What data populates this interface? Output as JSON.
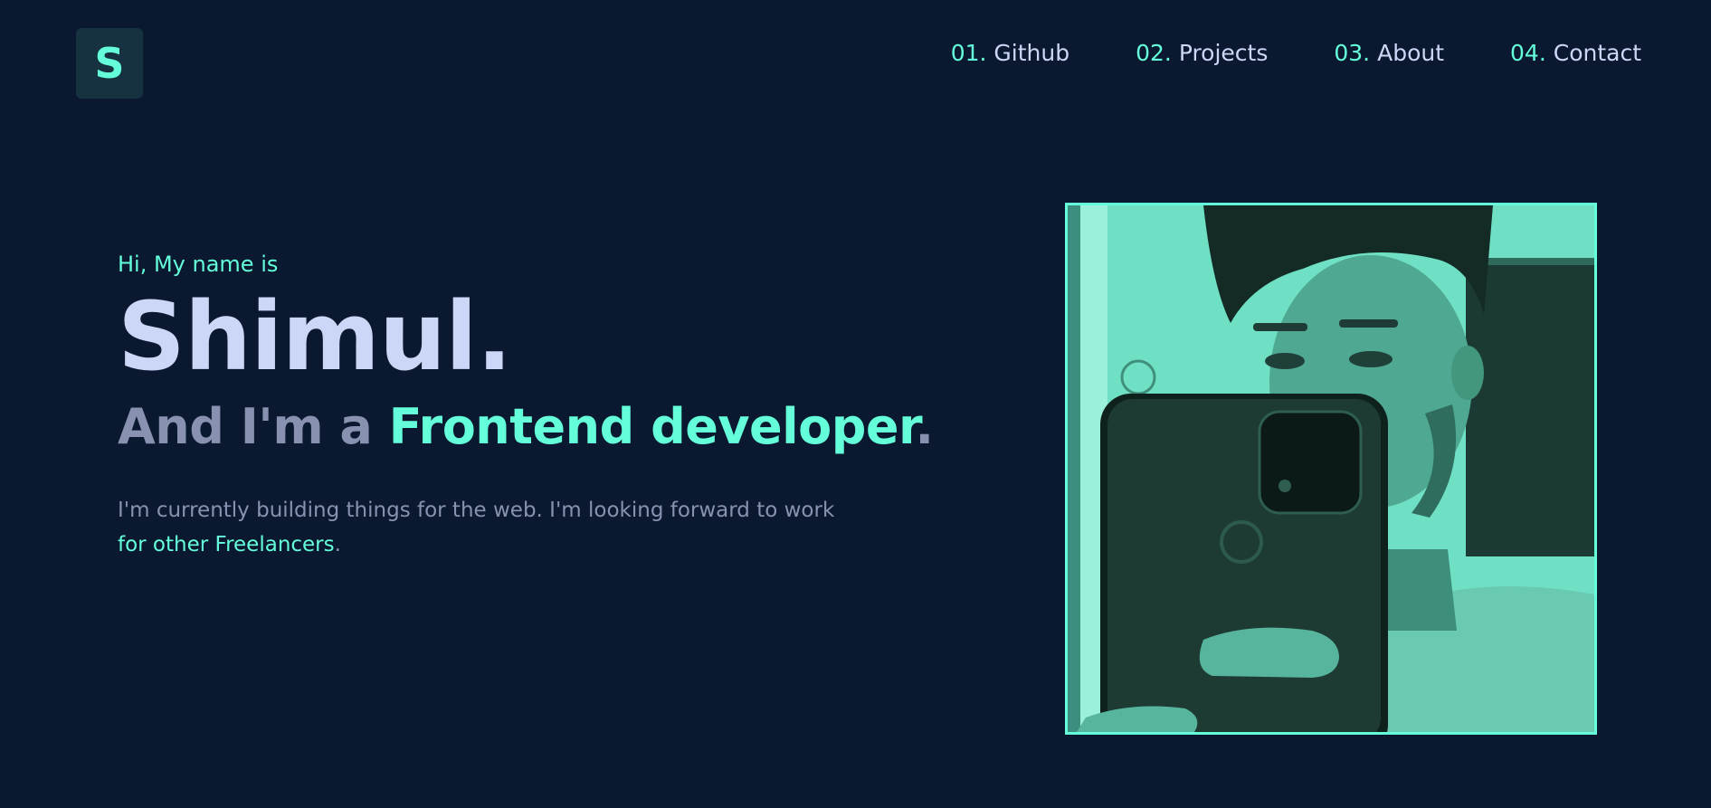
{
  "logo": {
    "letter": "S"
  },
  "nav": {
    "items": [
      {
        "num": "01.",
        "label": "Github"
      },
      {
        "num": "02.",
        "label": "Projects"
      },
      {
        "num": "03.",
        "label": "About"
      },
      {
        "num": "04.",
        "label": "Contact"
      }
    ]
  },
  "hero": {
    "greeting": "Hi, My name is",
    "name": "Shimul.",
    "tagline_prefix": "And I'm a ",
    "tagline_role": "Frontend developer",
    "tagline_suffix": ".",
    "desc_text": "I'm currently building things for the web. I'm looking forward to work ",
    "desc_link": "for other Freelancers",
    "desc_end": "."
  },
  "colors": {
    "background": "#0a192f",
    "accent": "#64ffda",
    "heading": "#ccd6f6",
    "muted": "#8892b0"
  }
}
